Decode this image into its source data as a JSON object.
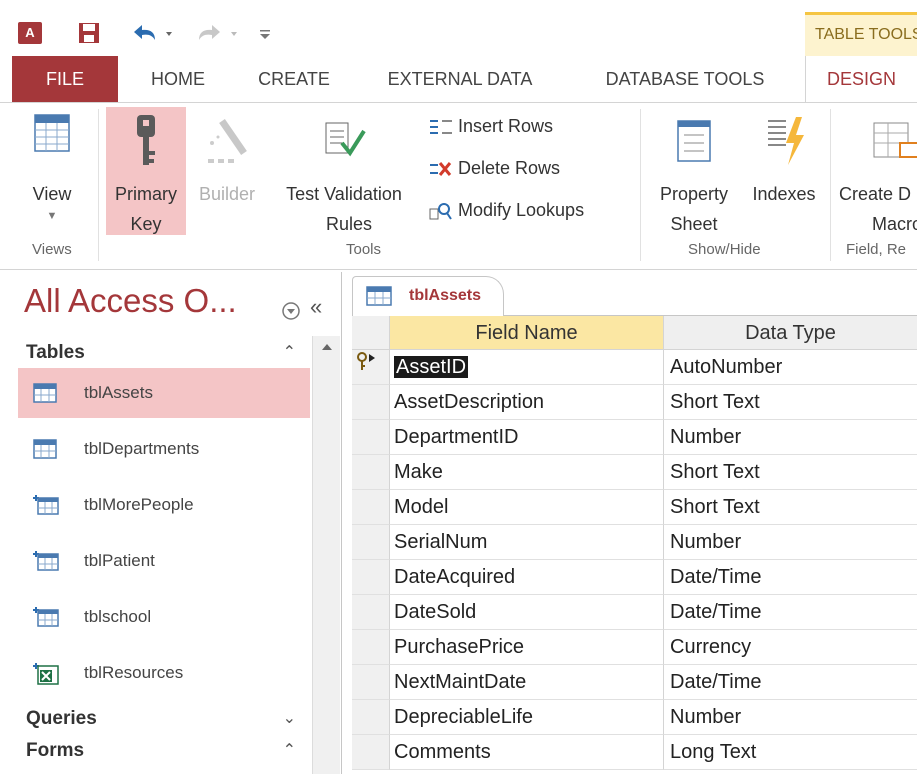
{
  "qat": {
    "app_logo": "A",
    "table_tools_label": "TABLE TOOLS"
  },
  "tabs": {
    "file": "FILE",
    "home": "HOME",
    "create": "CREATE",
    "external": "EXTERNAL DATA",
    "dbtools": "DATABASE TOOLS",
    "design": "DESIGN"
  },
  "ribbon": {
    "view": "View",
    "primary_key_1": "Primary",
    "primary_key_2": "Key",
    "builder": "Builder",
    "test_validation_1": "Test Validation",
    "test_validation_2": "Rules",
    "insert_rows": "Insert Rows",
    "delete_rows": "Delete Rows",
    "modify_lookups": "Modify Lookups",
    "property_sheet_1": "Property",
    "property_sheet_2": "Sheet",
    "indexes": "Indexes",
    "create_macro_1": "Create D",
    "create_macro_2": "Macro",
    "group_views": "Views",
    "group_tools": "Tools",
    "group_showhide": "Show/Hide",
    "group_field": "Field, Re"
  },
  "nav": {
    "title": "All Access O...",
    "sections": {
      "tables": "Tables",
      "queries": "Queries",
      "forms": "Forms"
    },
    "items": [
      {
        "label": "tblAssets",
        "icon": "table-icon"
      },
      {
        "label": "tblDepartments",
        "icon": "table-icon"
      },
      {
        "label": "tblMorePeople",
        "icon": "linked-table-icon"
      },
      {
        "label": "tblPatient",
        "icon": "linked-table-icon"
      },
      {
        "label": "tblschool",
        "icon": "linked-table-icon"
      },
      {
        "label": "tblResources",
        "icon": "linked-excel-icon"
      }
    ]
  },
  "doc": {
    "tab_label": "tblAssets",
    "col_field": "Field Name",
    "col_type": "Data Type",
    "rows": [
      {
        "name": "AssetID",
        "type": "AutoNumber"
      },
      {
        "name": "AssetDescription",
        "type": "Short Text"
      },
      {
        "name": "DepartmentID",
        "type": "Number"
      },
      {
        "name": "Make",
        "type": "Short Text"
      },
      {
        "name": "Model",
        "type": "Short Text"
      },
      {
        "name": "SerialNum",
        "type": "Number"
      },
      {
        "name": "DateAcquired",
        "type": "Date/Time"
      },
      {
        "name": "DateSold",
        "type": "Date/Time"
      },
      {
        "name": "PurchasePrice",
        "type": "Currency"
      },
      {
        "name": "NextMaintDate",
        "type": "Date/Time"
      },
      {
        "name": "DepreciableLife",
        "type": "Number"
      },
      {
        "name": "Comments",
        "type": "Long Text"
      }
    ]
  },
  "colors": {
    "accent": "#a4373a",
    "selection": "#f4c5c6",
    "header_highlight": "#fbe7a3"
  }
}
